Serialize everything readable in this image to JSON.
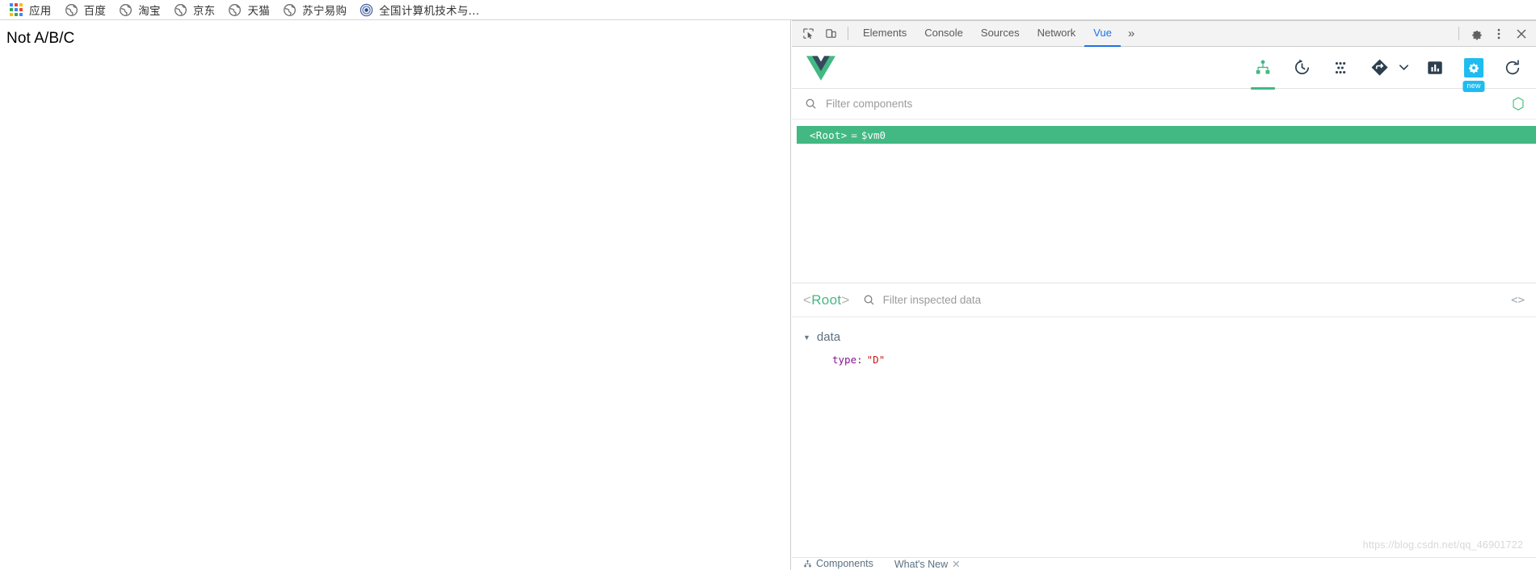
{
  "bookmarks_bar": {
    "items": [
      {
        "label": "应用",
        "icon": "apps-grid-icon"
      },
      {
        "label": "百度",
        "icon": "globe-icon"
      },
      {
        "label": "淘宝",
        "icon": "globe-icon"
      },
      {
        "label": "京东",
        "icon": "globe-icon"
      },
      {
        "label": "天猫",
        "icon": "globe-icon"
      },
      {
        "label": "苏宁易购",
        "icon": "globe-icon"
      },
      {
        "label": "全国计算机技术与...",
        "icon": "certificate-seal-icon"
      }
    ]
  },
  "page": {
    "body_text": "Not A/B/C"
  },
  "devtools": {
    "tabs": [
      {
        "label": "Elements",
        "active": false
      },
      {
        "label": "Console",
        "active": false
      },
      {
        "label": "Sources",
        "active": false
      },
      {
        "label": "Network",
        "active": false
      },
      {
        "label": "Vue",
        "active": true
      }
    ],
    "more_tabs_label": "»",
    "icons": {
      "inspect": "inspect-element-icon",
      "device": "device-toolbar-icon",
      "settings": "gear-icon",
      "kebab": "more-options-icon",
      "close": "close-icon"
    }
  },
  "vue_devtools": {
    "logo": "vue-logo-icon",
    "toolbar": [
      {
        "name": "components-tab-icon",
        "title": "Components",
        "active": true
      },
      {
        "name": "timeline-history-icon",
        "title": "Timeline",
        "active": false
      },
      {
        "name": "vuex-dots-icon",
        "title": "Vuex",
        "active": false
      },
      {
        "name": "router-icon",
        "title": "Routing",
        "active": false
      },
      {
        "name": "performance-bar-chart-icon",
        "title": "Performance",
        "active": false
      },
      {
        "name": "settings-gear-icon",
        "title": "Settings",
        "active": false,
        "badge": "new",
        "highlight_color": "#1fbcf0"
      },
      {
        "name": "refresh-icon",
        "title": "Refresh",
        "active": false
      }
    ],
    "filter": {
      "placeholder": "Filter components",
      "value": "",
      "search_icon": "search-icon",
      "select_icon": "hexagon-select-icon"
    },
    "tree": {
      "rows": [
        {
          "tag": "<Root>",
          "equals": "=",
          "instance": "$vm0",
          "selected": true
        }
      ]
    },
    "inspector": {
      "root_open": "<",
      "root_name": "Root",
      "root_close": ">",
      "filter_placeholder": "Filter inspected data",
      "filter_value": "",
      "search_icon": "search-icon",
      "code_icon": "code-brackets-icon",
      "groups": [
        {
          "name": "data",
          "expanded": true,
          "caret": "▼",
          "props": [
            {
              "key": "type",
              "colon": ":",
              "value": "\"D\""
            }
          ]
        }
      ]
    },
    "footer": [
      {
        "label": "Components",
        "icon": "components-footer-icon"
      },
      {
        "label": "What's New",
        "icon": "whats-new-icon",
        "close": "✕"
      }
    ]
  },
  "watermark": "https://blog.csdn.net/qq_46901722",
  "colors": {
    "vue_green": "#42b983",
    "vue_navy": "#35495e",
    "devtools_blue": "#1a73e8",
    "settings_cyan": "#1fbcf0",
    "string_red": "#c41a16",
    "key_purple": "#881391"
  }
}
